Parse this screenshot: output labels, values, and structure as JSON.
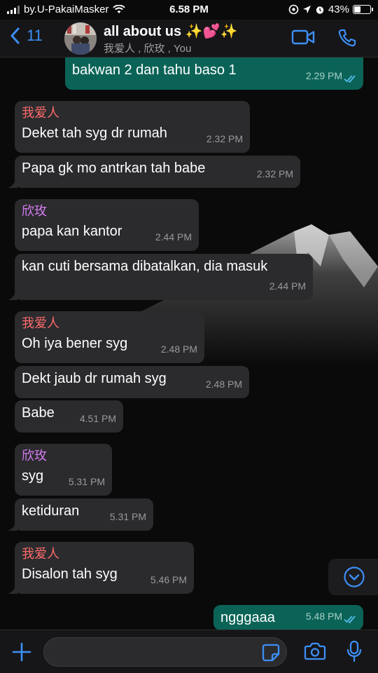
{
  "status_bar": {
    "carrier": "by.U-PakaiMasker",
    "time": "6.58 PM",
    "battery": "43%",
    "battery_level": 0.43,
    "icons": [
      "signal-icon",
      "wifi-icon",
      "location-lock-icon",
      "navigation-icon",
      "alarm-icon",
      "battery-icon"
    ]
  },
  "header": {
    "back_count": "11",
    "title": "all about us ✨💕✨",
    "subtitle": "我爱人 , 欣玫 , You",
    "icons": [
      "back-chevron-icon",
      "video-call-icon",
      "phone-call-icon"
    ]
  },
  "colors": {
    "accent": "#3d8ff5",
    "outgoing_bubble": "#0b6357",
    "incoming_bubble": "#2b2b2e",
    "sender_1": "#ff6b6b",
    "sender_2": "#d47cf0",
    "read_tick": "#53bdeb"
  },
  "messages": [
    {
      "dir": "out",
      "sender": "",
      "text": "bakwan 2 dan tahu baso 1",
      "time": "2.29 PM",
      "read": true
    },
    {
      "dir": "in",
      "sender": "我爱人",
      "sender_color": "#ff6b6b",
      "text": "Deket tah syg dr rumah",
      "time": "2.32 PM"
    },
    {
      "dir": "in",
      "sender": "",
      "text": "Papa gk mo antrkan tah babe",
      "time": "2.32 PM"
    },
    {
      "dir": "in",
      "sender": "欣玫",
      "sender_color": "#d47cf0",
      "text": "papa kan kantor",
      "time": "2.44 PM"
    },
    {
      "dir": "in",
      "sender": "",
      "text": "kan cuti bersama dibatalkan, dia masuk",
      "time": "2.44 PM"
    },
    {
      "dir": "in",
      "sender": "我爱人",
      "sender_color": "#ff6b6b",
      "text": "Oh iya bener syg",
      "time": "2.48 PM"
    },
    {
      "dir": "in",
      "sender": "",
      "text": "Dekt jaub dr rumah syg",
      "time": "2.48 PM"
    },
    {
      "dir": "in",
      "sender": "",
      "text": "Babe",
      "time": "4.51 PM"
    },
    {
      "dir": "in",
      "sender": "欣玫",
      "sender_color": "#d47cf0",
      "text": "syg",
      "time": "5.31 PM"
    },
    {
      "dir": "in",
      "sender": "",
      "text": "ketiduran",
      "time": "5.31 PM"
    },
    {
      "dir": "in",
      "sender": "我爱人",
      "sender_color": "#ff6b6b",
      "text": "Disalon tah syg",
      "time": "5.46 PM"
    },
    {
      "dir": "out",
      "sender": "",
      "text": "ngggaaa",
      "time": "5.48 PM",
      "read": true
    }
  ],
  "input": {
    "value": "",
    "placeholder": "",
    "icons": [
      "plus-icon",
      "sticker-icon",
      "camera-icon",
      "microphone-icon"
    ]
  },
  "scroll_down_icon": "chevron-down-circle-icon"
}
